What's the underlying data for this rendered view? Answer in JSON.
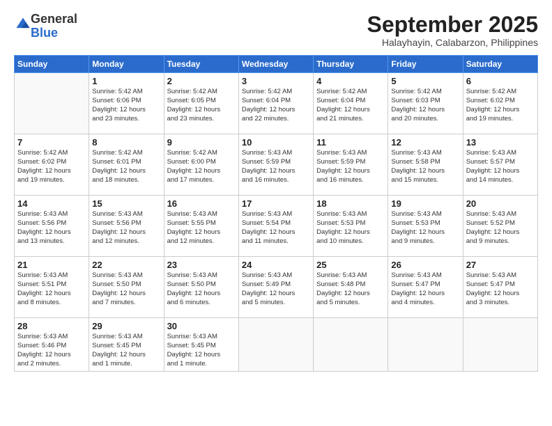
{
  "header": {
    "logo_general": "General",
    "logo_blue": "Blue",
    "month": "September 2025",
    "location": "Halayhayin, Calabarzon, Philippines"
  },
  "days_of_week": [
    "Sunday",
    "Monday",
    "Tuesday",
    "Wednesday",
    "Thursday",
    "Friday",
    "Saturday"
  ],
  "weeks": [
    [
      {
        "day": "",
        "info": ""
      },
      {
        "day": "1",
        "info": "Sunrise: 5:42 AM\nSunset: 6:06 PM\nDaylight: 12 hours\nand 23 minutes."
      },
      {
        "day": "2",
        "info": "Sunrise: 5:42 AM\nSunset: 6:05 PM\nDaylight: 12 hours\nand 23 minutes."
      },
      {
        "day": "3",
        "info": "Sunrise: 5:42 AM\nSunset: 6:04 PM\nDaylight: 12 hours\nand 22 minutes."
      },
      {
        "day": "4",
        "info": "Sunrise: 5:42 AM\nSunset: 6:04 PM\nDaylight: 12 hours\nand 21 minutes."
      },
      {
        "day": "5",
        "info": "Sunrise: 5:42 AM\nSunset: 6:03 PM\nDaylight: 12 hours\nand 20 minutes."
      },
      {
        "day": "6",
        "info": "Sunrise: 5:42 AM\nSunset: 6:02 PM\nDaylight: 12 hours\nand 19 minutes."
      }
    ],
    [
      {
        "day": "7",
        "info": "Sunrise: 5:42 AM\nSunset: 6:02 PM\nDaylight: 12 hours\nand 19 minutes."
      },
      {
        "day": "8",
        "info": "Sunrise: 5:42 AM\nSunset: 6:01 PM\nDaylight: 12 hours\nand 18 minutes."
      },
      {
        "day": "9",
        "info": "Sunrise: 5:42 AM\nSunset: 6:00 PM\nDaylight: 12 hours\nand 17 minutes."
      },
      {
        "day": "10",
        "info": "Sunrise: 5:43 AM\nSunset: 5:59 PM\nDaylight: 12 hours\nand 16 minutes."
      },
      {
        "day": "11",
        "info": "Sunrise: 5:43 AM\nSunset: 5:59 PM\nDaylight: 12 hours\nand 16 minutes."
      },
      {
        "day": "12",
        "info": "Sunrise: 5:43 AM\nSunset: 5:58 PM\nDaylight: 12 hours\nand 15 minutes."
      },
      {
        "day": "13",
        "info": "Sunrise: 5:43 AM\nSunset: 5:57 PM\nDaylight: 12 hours\nand 14 minutes."
      }
    ],
    [
      {
        "day": "14",
        "info": "Sunrise: 5:43 AM\nSunset: 5:56 PM\nDaylight: 12 hours\nand 13 minutes."
      },
      {
        "day": "15",
        "info": "Sunrise: 5:43 AM\nSunset: 5:56 PM\nDaylight: 12 hours\nand 12 minutes."
      },
      {
        "day": "16",
        "info": "Sunrise: 5:43 AM\nSunset: 5:55 PM\nDaylight: 12 hours\nand 12 minutes."
      },
      {
        "day": "17",
        "info": "Sunrise: 5:43 AM\nSunset: 5:54 PM\nDaylight: 12 hours\nand 11 minutes."
      },
      {
        "day": "18",
        "info": "Sunrise: 5:43 AM\nSunset: 5:53 PM\nDaylight: 12 hours\nand 10 minutes."
      },
      {
        "day": "19",
        "info": "Sunrise: 5:43 AM\nSunset: 5:53 PM\nDaylight: 12 hours\nand 9 minutes."
      },
      {
        "day": "20",
        "info": "Sunrise: 5:43 AM\nSunset: 5:52 PM\nDaylight: 12 hours\nand 9 minutes."
      }
    ],
    [
      {
        "day": "21",
        "info": "Sunrise: 5:43 AM\nSunset: 5:51 PM\nDaylight: 12 hours\nand 8 minutes."
      },
      {
        "day": "22",
        "info": "Sunrise: 5:43 AM\nSunset: 5:50 PM\nDaylight: 12 hours\nand 7 minutes."
      },
      {
        "day": "23",
        "info": "Sunrise: 5:43 AM\nSunset: 5:50 PM\nDaylight: 12 hours\nand 6 minutes."
      },
      {
        "day": "24",
        "info": "Sunrise: 5:43 AM\nSunset: 5:49 PM\nDaylight: 12 hours\nand 5 minutes."
      },
      {
        "day": "25",
        "info": "Sunrise: 5:43 AM\nSunset: 5:48 PM\nDaylight: 12 hours\nand 5 minutes."
      },
      {
        "day": "26",
        "info": "Sunrise: 5:43 AM\nSunset: 5:47 PM\nDaylight: 12 hours\nand 4 minutes."
      },
      {
        "day": "27",
        "info": "Sunrise: 5:43 AM\nSunset: 5:47 PM\nDaylight: 12 hours\nand 3 minutes."
      }
    ],
    [
      {
        "day": "28",
        "info": "Sunrise: 5:43 AM\nSunset: 5:46 PM\nDaylight: 12 hours\nand 2 minutes."
      },
      {
        "day": "29",
        "info": "Sunrise: 5:43 AM\nSunset: 5:45 PM\nDaylight: 12 hours\nand 1 minute."
      },
      {
        "day": "30",
        "info": "Sunrise: 5:43 AM\nSunset: 5:45 PM\nDaylight: 12 hours\nand 1 minute."
      },
      {
        "day": "",
        "info": ""
      },
      {
        "day": "",
        "info": ""
      },
      {
        "day": "",
        "info": ""
      },
      {
        "day": "",
        "info": ""
      }
    ]
  ]
}
